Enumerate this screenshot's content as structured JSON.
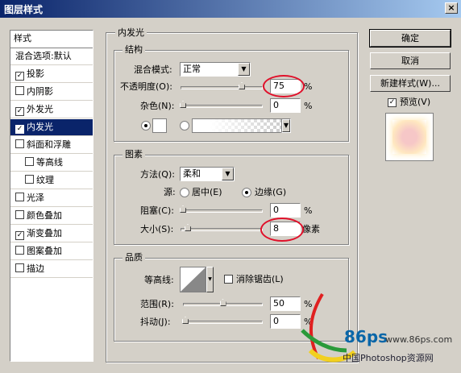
{
  "window": {
    "title": "图层样式",
    "close": "×"
  },
  "sidebar": {
    "items": [
      {
        "label": "样式",
        "type": "header",
        "checked": null
      },
      {
        "label": "混合选项:默认",
        "type": "item",
        "checked": null
      },
      {
        "label": "投影",
        "type": "item",
        "checked": true
      },
      {
        "label": "内阴影",
        "type": "item",
        "checked": false
      },
      {
        "label": "外发光",
        "type": "item",
        "checked": true
      },
      {
        "label": "内发光",
        "type": "item",
        "checked": true,
        "selected": true
      },
      {
        "label": "斜面和浮雕",
        "type": "item",
        "checked": false
      },
      {
        "label": "等高线",
        "type": "sub",
        "checked": false
      },
      {
        "label": "纹理",
        "type": "sub",
        "checked": false
      },
      {
        "label": "光泽",
        "type": "item",
        "checked": false
      },
      {
        "label": "颜色叠加",
        "type": "item",
        "checked": false
      },
      {
        "label": "渐变叠加",
        "type": "item",
        "checked": true
      },
      {
        "label": "图案叠加",
        "type": "item",
        "checked": false
      },
      {
        "label": "描边",
        "type": "item",
        "checked": false
      }
    ]
  },
  "panel": {
    "title": "内发光",
    "structure": {
      "title": "结构",
      "blend_label": "混合模式:",
      "blend_value": "正常",
      "opacity_label": "不透明度(O):",
      "opacity_value": "75",
      "opacity_unit": "%",
      "noise_label": "杂色(N):",
      "noise_value": "0",
      "noise_unit": "%"
    },
    "elements": {
      "title": "图素",
      "method_label": "方法(Q):",
      "method_value": "柔和",
      "source_label": "源:",
      "source_center": "居中(E)",
      "source_edge": "边缘(G)",
      "choke_label": "阻塞(C):",
      "choke_value": "0",
      "choke_unit": "%",
      "size_label": "大小(S):",
      "size_value": "8",
      "size_unit": "像素"
    },
    "quality": {
      "title": "品质",
      "contour_label": "等高线:",
      "antialias_label": "消除锯齿(L)",
      "range_label": "范围(R):",
      "range_value": "50",
      "range_unit": "%",
      "jitter_label": "抖动(J):",
      "jitter_value": "0",
      "jitter_unit": "%"
    }
  },
  "buttons": {
    "ok": "确定",
    "cancel": "取消",
    "new_style": "新建样式(W)...",
    "preview": "预览(V)"
  },
  "watermark": {
    "brand": "86ps",
    "url": "www.86ps.com",
    "site": "中国Photoshop资源网"
  },
  "colors": {
    "title_bar": "#0a246a",
    "highlight_circle": "#e0102a",
    "selection": "#0a246a"
  }
}
